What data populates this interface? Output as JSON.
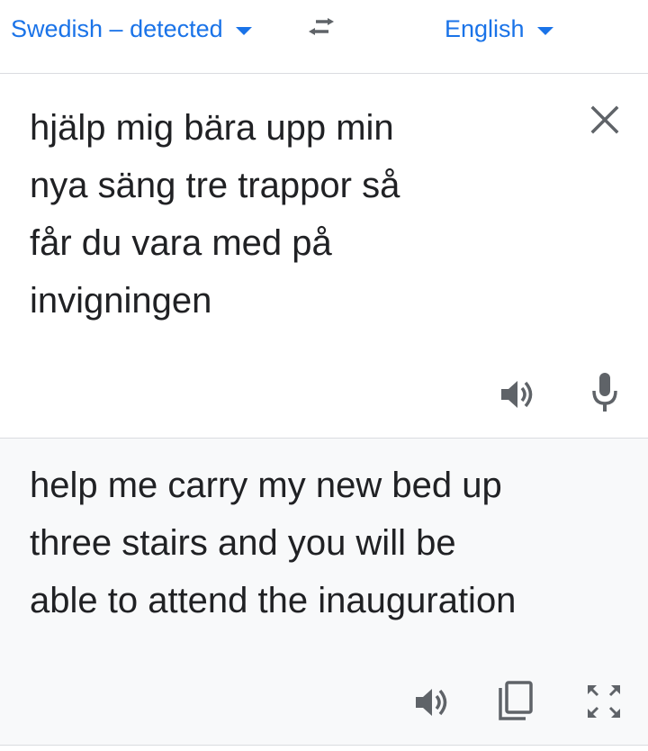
{
  "lang_bar": {
    "source_language": "Swedish – detected",
    "target_language": "English",
    "swap_icon": "swap-arrows-icon",
    "accent_color": "#1a73e8"
  },
  "source": {
    "text": "hjälp mig bära upp min\nnya säng tre trappor så\nfår du vara med på\ninvigningen",
    "icons": [
      "close-icon",
      "speaker-icon",
      "microphone-icon"
    ]
  },
  "result": {
    "text": "help me carry my new bed up\nthree stairs and you will be\nable to attend the inauguration",
    "icons": [
      "speaker-icon",
      "copy-icon",
      "fullscreen-icon"
    ]
  }
}
